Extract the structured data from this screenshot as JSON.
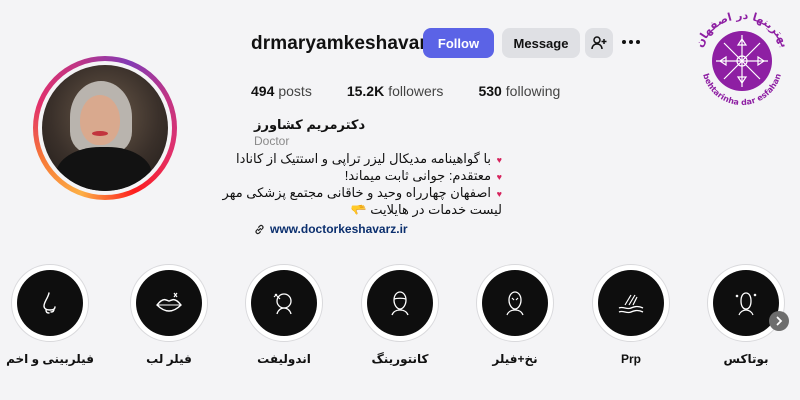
{
  "profile": {
    "username": "drmaryamkeshavarz",
    "full_name": "دکترمریم کشاورز",
    "category": "Doctor",
    "follow_label": "Follow",
    "message_label": "Message",
    "stats": {
      "posts_count": "494",
      "posts_label": "posts",
      "followers_count": "15.2K",
      "followers_label": "followers",
      "following_count": "530",
      "following_label": "following"
    },
    "bio_lines": [
      "با گواهینامه مدیکال لیزر تراپی و استتیک از کانادا",
      "معتقدم: جوانی ثابت میماند!",
      "اصفهان چهارراه وحید و خاقانی مجتمع پزشکی مهر",
      "لیست خدمات در هایلایت 🫳"
    ],
    "website": "www.doctorkeshavarz.ir"
  },
  "highlights": [
    {
      "label": "فیلربینی و اخم",
      "icon": "nose-icon"
    },
    {
      "label": "فیلر لب",
      "icon": "lips-icon"
    },
    {
      "label": "اندولیفت",
      "icon": "face-lift-icon"
    },
    {
      "label": "کانتورینگ",
      "icon": "face-contour-icon"
    },
    {
      "label": "نخ+فیلر",
      "icon": "face-thread-icon"
    },
    {
      "label": "Prp",
      "icon": "prp-skin-icon"
    },
    {
      "label": "بوتاکس",
      "icon": "botox-face-icon"
    }
  ],
  "watermark": {
    "text_top": "بهترینها در اصفهان",
    "text_bottom": "behtarinha dar esfahan",
    "color": "#8e1fa3"
  },
  "colors": {
    "follow_button": "#5b63e6",
    "secondary_button": "#dfe0e4",
    "heart": "#d6235d",
    "link": "#0b2f6e"
  }
}
